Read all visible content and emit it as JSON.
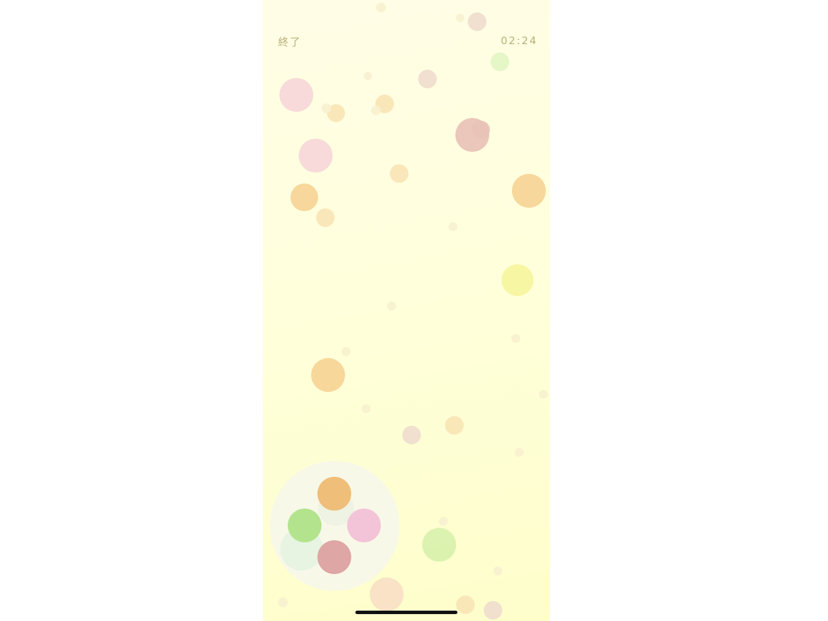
{
  "header": {
    "quit_label": "終了",
    "timer": "02:24"
  },
  "palette": {
    "colors": {
      "orange": "#efbe79",
      "green": "#b4e38d",
      "pink": "#f3c4d7",
      "red": "#dea6a4",
      "ghost_green": "#e7f4e2",
      "ghost_white": "#eef3e3"
    }
  },
  "bubble_colors": {
    "pink": "#f6d7d8",
    "orange": "#f6d495",
    "light_orange": "#fae5b5",
    "brown": "#f0ddce",
    "rose": "#e8c2b6",
    "green": "#e3f5c4",
    "yellow": "#f6f59d",
    "faint": "#f8f1cf",
    "peach": "#f8dfc4",
    "lime": "#d8f1ad"
  }
}
